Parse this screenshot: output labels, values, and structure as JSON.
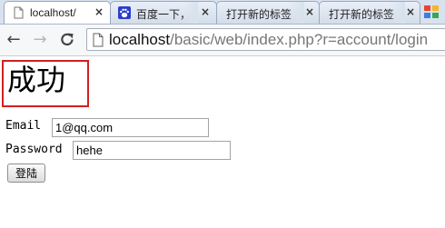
{
  "browser": {
    "tabs": [
      {
        "title": "localhost/",
        "active": true,
        "favicon": "page-icon"
      },
      {
        "title": "百度一下，",
        "active": false,
        "favicon": "baidu-paw-icon"
      },
      {
        "title": "打开新的标签",
        "active": false,
        "favicon": "none"
      },
      {
        "title": "打开新的标签",
        "active": false,
        "favicon": "none"
      }
    ],
    "close_glyph": "×",
    "url": {
      "host": "localhost",
      "path": "/basic/web/index.php?r=account/login"
    }
  },
  "page": {
    "heading": "成功",
    "form": {
      "email_label": "Email",
      "email_value": "1@qq.com",
      "password_label": "Password",
      "password_value": "hehe",
      "submit_label": "登陆"
    }
  },
  "colors": {
    "highlight_border": "#d02020",
    "tabstrip": "#d8e2ef"
  }
}
